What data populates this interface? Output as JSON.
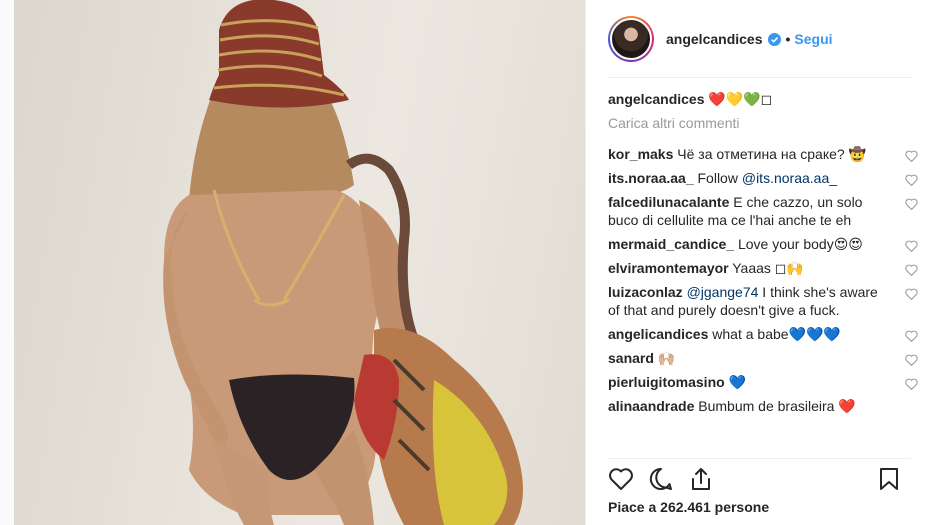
{
  "header": {
    "username": "angelcandices",
    "separator": "•",
    "follow_label": "Segui"
  },
  "caption": {
    "username": "angelcandices",
    "text": "❤️💛💚◻"
  },
  "load_more_label": "Carica altri commenti",
  "comments": [
    {
      "username": "kor_maks",
      "text": "Чё за отметина на сраке? 🤠"
    },
    {
      "username": "its.noraa.aa_",
      "text": "Follow ",
      "mention": "@its.noraa.aa_",
      "after": ""
    },
    {
      "username": "falcedilunacalante",
      "text": "E che cazzo, un solo buco di cellulite ma ce l'hai anche te eh"
    },
    {
      "username": "mermaid_candice_",
      "text": "Love your body😍😍"
    },
    {
      "username": "elviramontemayor",
      "text": "Yaaas ◻🙌"
    },
    {
      "username": "luizaconlaz",
      "text": " ",
      "mention": "@jgange74",
      "after": " I think she's aware of that and purely doesn't give a fuck."
    },
    {
      "username": "angelicandices",
      "text": "what a babe💙💙💙"
    },
    {
      "username": "sanard",
      "text": "🙌🏼"
    },
    {
      "username": "pierluigitomasino",
      "text": "💙"
    },
    {
      "username": "alinaandrade",
      "text": "Bumbum de brasileira ❤️"
    }
  ],
  "likes_text": "Piace a 262.461 persone",
  "icons": {
    "verified": "verified-badge-icon",
    "like": "heart-icon",
    "comment": "comment-bubble-icon",
    "share": "share-icon",
    "save": "bookmark-icon"
  },
  "colors": {
    "link_blue": "#3897f0",
    "mention_blue": "#003569",
    "muted": "#999999",
    "text": "#262626"
  }
}
